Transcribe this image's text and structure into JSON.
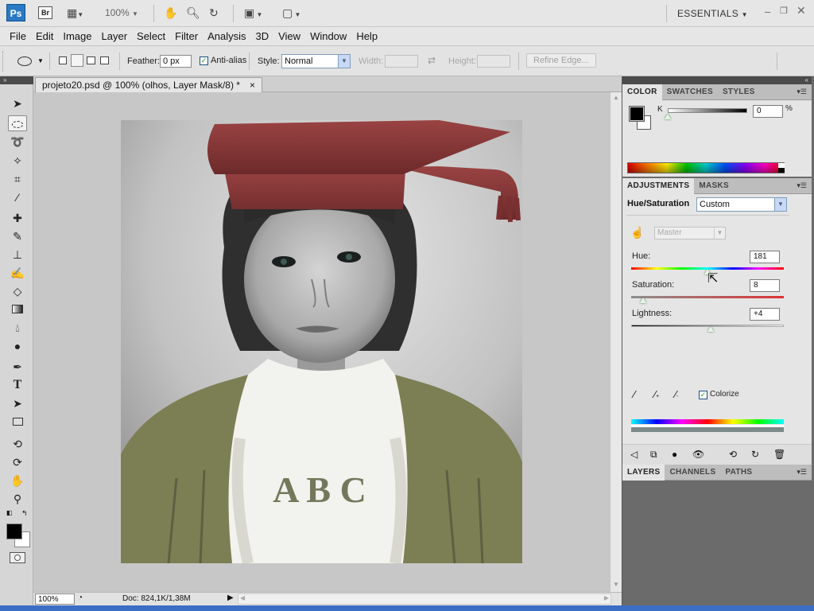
{
  "appbar": {
    "logo": "Ps",
    "bridge": "Br",
    "zoom": "100%",
    "workspace": "ESSENTIALS"
  },
  "menu": [
    "File",
    "Edit",
    "Image",
    "Layer",
    "Select",
    "Filter",
    "Analysis",
    "3D",
    "View",
    "Window",
    "Help"
  ],
  "options": {
    "feather_label": "Feather:",
    "feather_value": "0 px",
    "antialias_label": "Anti-alias",
    "antialias_checked": true,
    "style_label": "Style:",
    "style_value": "Normal",
    "width_label": "Width:",
    "height_label": "Height:",
    "refine_edge": "Refine Edge..."
  },
  "document": {
    "tab_title": "projeto20.psd @ 100% (olhos, Layer Mask/8) *",
    "close": "×",
    "status_zoom": "100%",
    "doc_info": "Doc: 824,1K/1,38M",
    "image_text": "A B C"
  },
  "color_panel": {
    "tabs": [
      "COLOR",
      "SWATCHES",
      "STYLES"
    ],
    "channel_label": "K",
    "value": "0",
    "unit": "%",
    "k_level": 0
  },
  "adjustments_panel": {
    "tabs": [
      "ADJUSTMENTS",
      "MASKS"
    ],
    "title": "Hue/Saturation",
    "preset": "Custom",
    "channel": "Master",
    "hue_label": "Hue:",
    "hue_value": "181",
    "saturation_label": "Saturation:",
    "saturation_value": "8",
    "lightness_label": "Lightness:",
    "lightness_value": "+4",
    "hue_level": 0.5,
    "saturation_level": 0.08,
    "lightness_level": 0.52,
    "colorize_label": "Colorize",
    "colorize_checked": true
  },
  "layers_panel": {
    "tabs": [
      "LAYERS",
      "CHANNELS",
      "PATHS"
    ]
  },
  "colors": {
    "accent": "#3b6ec5",
    "hat": "#8b3a3a",
    "gown": "#7c7f54",
    "panel_bg": "#e5e5e5",
    "workspace": "#6b6b6b"
  }
}
